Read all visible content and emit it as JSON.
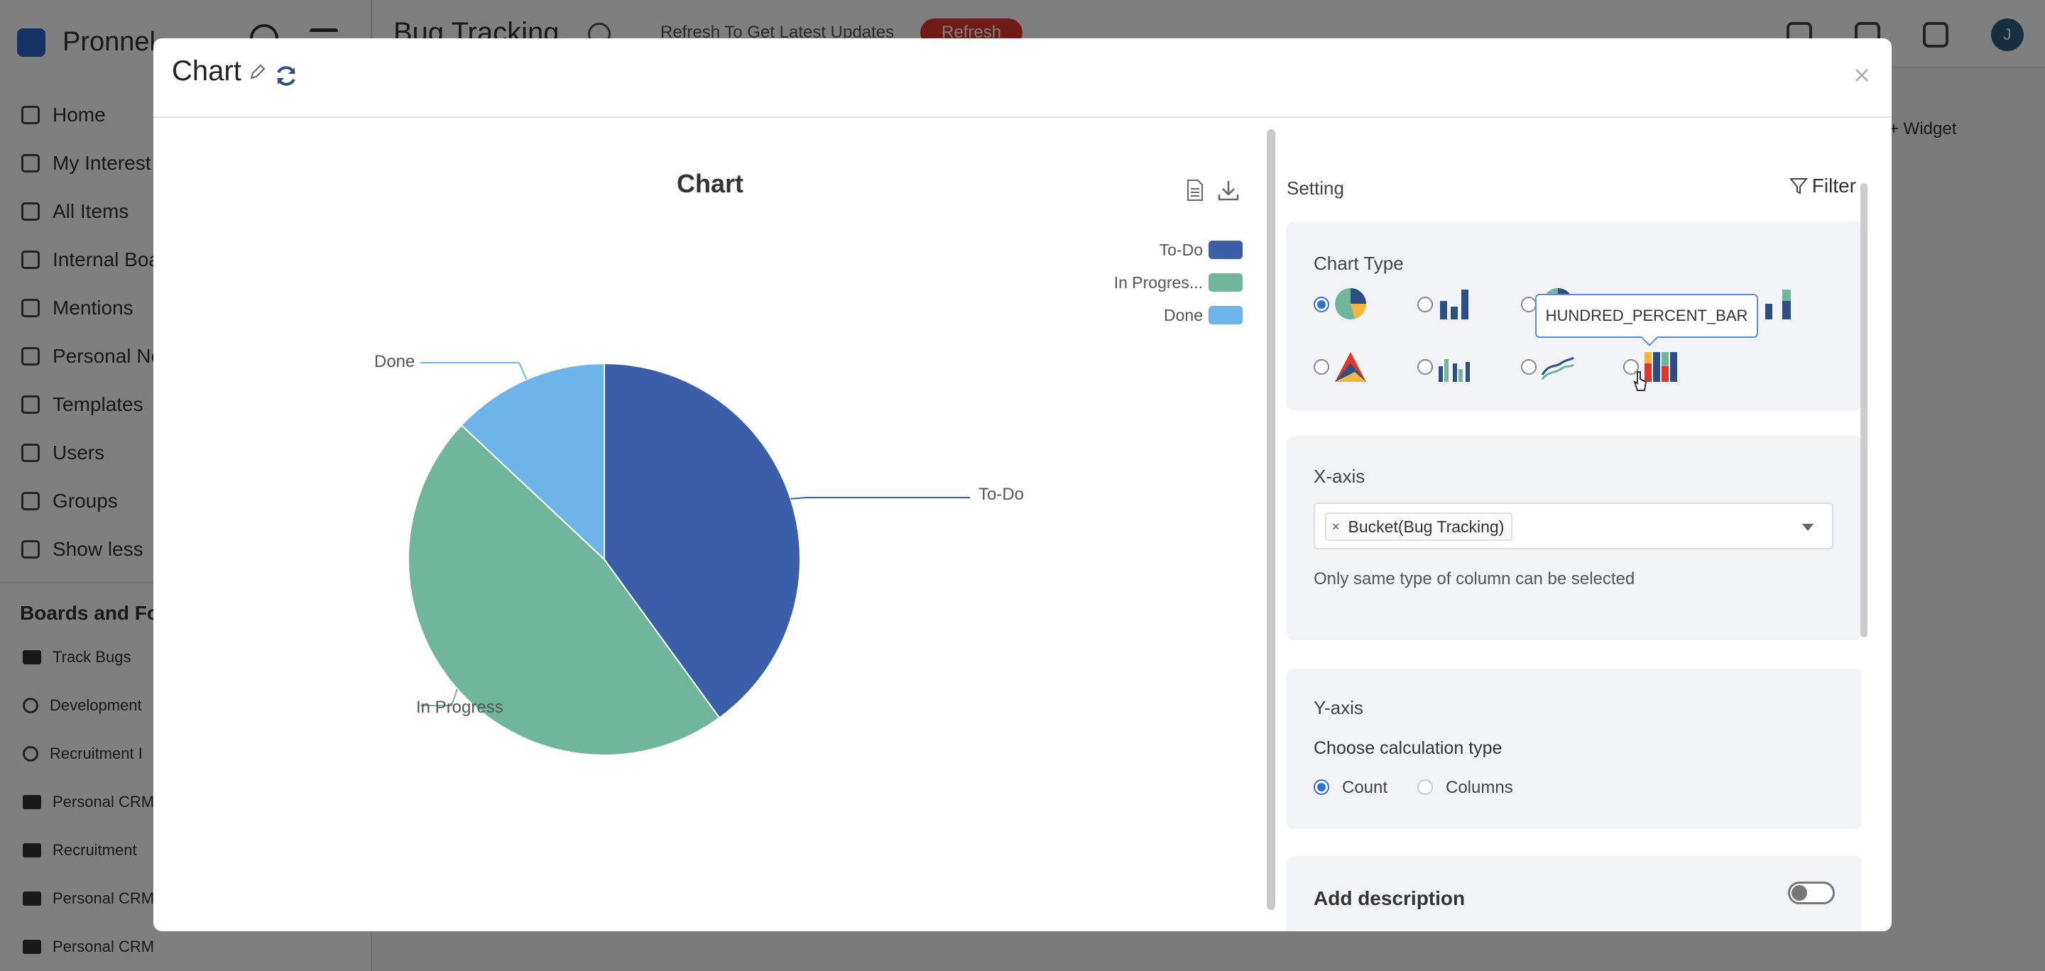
{
  "app": {
    "name": "Pronnel",
    "page_title": "Bug Tracking",
    "refresh_text": "Refresh To Get Latest Updates",
    "refresh_button": "Refresh",
    "avatar_initial": "J",
    "add_widget": "+ Widget",
    "sidebar": {
      "items": [
        {
          "label": "Home",
          "icon": "home-icon"
        },
        {
          "label": "My Interest",
          "icon": "target-icon"
        },
        {
          "label": "All Items",
          "icon": "tag-icon"
        },
        {
          "label": "Internal Boa",
          "icon": "grid-icon"
        },
        {
          "label": "Mentions",
          "icon": "at-icon"
        },
        {
          "label": "Personal No",
          "icon": "note-icon"
        },
        {
          "label": "Templates",
          "icon": "template-icon"
        },
        {
          "label": "Users",
          "icon": "user-icon"
        },
        {
          "label": "Groups",
          "icon": "group-icon"
        },
        {
          "label": "Show less",
          "icon": "chevron-up-icon"
        }
      ],
      "section_title": "Boards and Fo",
      "boards": [
        {
          "label": "Track Bugs",
          "icon": "folder-icon"
        },
        {
          "label": "Development",
          "icon": "target-icon"
        },
        {
          "label": "Recruitment I",
          "icon": "target-icon"
        },
        {
          "label": "Personal CRM",
          "icon": "folder-icon"
        },
        {
          "label": "Recruitment",
          "icon": "folder-icon"
        },
        {
          "label": "Personal CRM",
          "icon": "folder-icon"
        },
        {
          "label": "Personal CRM",
          "icon": "folder-icon"
        }
      ]
    }
  },
  "modal": {
    "title": "Chart",
    "chart_title": "Chart",
    "settings_label": "Setting",
    "filter_label": "Filter",
    "chart_type": {
      "title": "Chart Type",
      "tooltip": "HUNDRED_PERCENT_BAR",
      "options": [
        "pie-chart-icon",
        "bar-chart-icon",
        "donut-chart-icon",
        "stacked-bar-icon",
        "area-chart-icon",
        "grouped-bar-icon",
        "line-chart-icon",
        "hundred-percent-bar-icon"
      ],
      "selected": 0
    },
    "x_axis": {
      "title": "X-axis",
      "tag": "Bucket(Bug Tracking)",
      "tag_remove": "×",
      "hint": "Only same type of column can be selected"
    },
    "y_axis": {
      "title": "Y-axis",
      "subtitle": "Choose calculation type",
      "options": [
        "Count",
        "Columns"
      ],
      "selected": "Count"
    },
    "description": {
      "title": "Add description",
      "enabled": false
    }
  },
  "chart_data": {
    "type": "pie",
    "title": "Chart",
    "legend_position": "top-right",
    "legend": [
      "To-Do",
      "In Progres...",
      "Done"
    ],
    "slices": [
      {
        "label": "To-Do",
        "value": 40,
        "color": "#3a5ea8"
      },
      {
        "label": "In Progress",
        "value": 47,
        "color": "#6fb69c"
      },
      {
        "label": "Done",
        "value": 13,
        "color": "#6cb4ea"
      }
    ]
  }
}
